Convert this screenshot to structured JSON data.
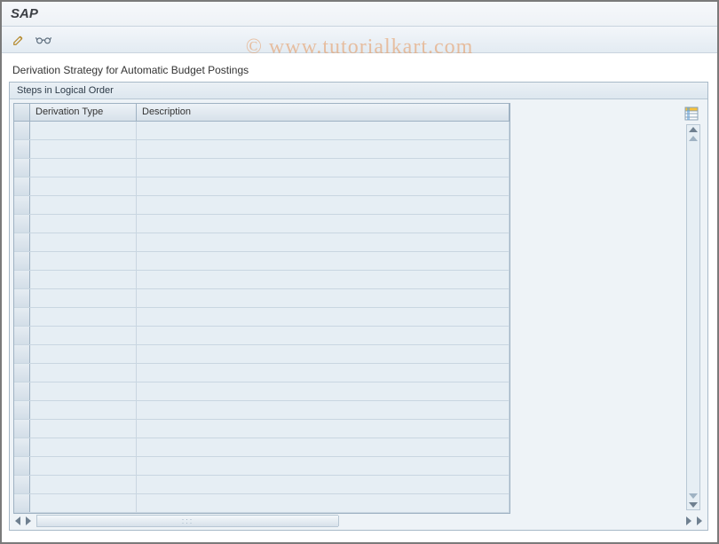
{
  "window": {
    "title": "SAP"
  },
  "toolbar": {
    "edit_tooltip": "Display/Change",
    "glasses_tooltip": "Display <-> Change"
  },
  "page": {
    "heading": "Derivation Strategy for Automatic Budget Postings"
  },
  "panel": {
    "title": "Steps in Logical Order",
    "columns": {
      "type": "Derivation Type",
      "desc": "Description"
    },
    "rows": [
      {
        "type": "",
        "desc": ""
      },
      {
        "type": "",
        "desc": ""
      },
      {
        "type": "",
        "desc": ""
      },
      {
        "type": "",
        "desc": ""
      },
      {
        "type": "",
        "desc": ""
      },
      {
        "type": "",
        "desc": ""
      },
      {
        "type": "",
        "desc": ""
      },
      {
        "type": "",
        "desc": ""
      },
      {
        "type": "",
        "desc": ""
      },
      {
        "type": "",
        "desc": ""
      },
      {
        "type": "",
        "desc": ""
      },
      {
        "type": "",
        "desc": ""
      },
      {
        "type": "",
        "desc": ""
      },
      {
        "type": "",
        "desc": ""
      },
      {
        "type": "",
        "desc": ""
      },
      {
        "type": "",
        "desc": ""
      },
      {
        "type": "",
        "desc": ""
      },
      {
        "type": "",
        "desc": ""
      },
      {
        "type": "",
        "desc": ""
      },
      {
        "type": "",
        "desc": ""
      },
      {
        "type": "",
        "desc": ""
      }
    ]
  },
  "watermark": "© www.tutorialkart.com"
}
